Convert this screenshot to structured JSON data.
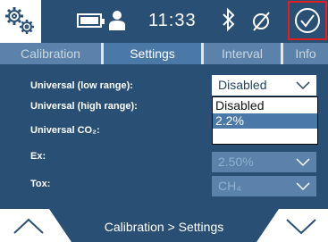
{
  "status": {
    "time": "11:33"
  },
  "tabs": [
    {
      "label": "Calibration"
    },
    {
      "label": "Settings"
    },
    {
      "label": "Interval"
    },
    {
      "label": "Info"
    }
  ],
  "settings": {
    "rows": [
      {
        "label": "Universal (low range):",
        "value": "Disabled"
      },
      {
        "label": "Universal (high range):",
        "value": ""
      },
      {
        "label": "Universal CO₂:",
        "value": ""
      },
      {
        "label": "Ex:",
        "value": "2.50%"
      },
      {
        "label": "Tox:",
        "value": "CH₄"
      }
    ],
    "dropdown": {
      "options": [
        "Disabled",
        "2.2%",
        ""
      ],
      "selected_index": 1
    }
  },
  "breadcrumb": "Calibration > Settings",
  "icons": {
    "settings": "gears-icon",
    "battery": "battery-icon",
    "user": "user-icon",
    "bluetooth": "bluetooth-icon",
    "no_signal": "no-signal-icon",
    "confirm": "check-circle-icon",
    "prev": "chevron-up-icon",
    "next": "chevron-down-icon"
  },
  "colors": {
    "background": "#2a4f74",
    "tab_active": "#4a79a8",
    "highlight_border": "#e02020"
  }
}
